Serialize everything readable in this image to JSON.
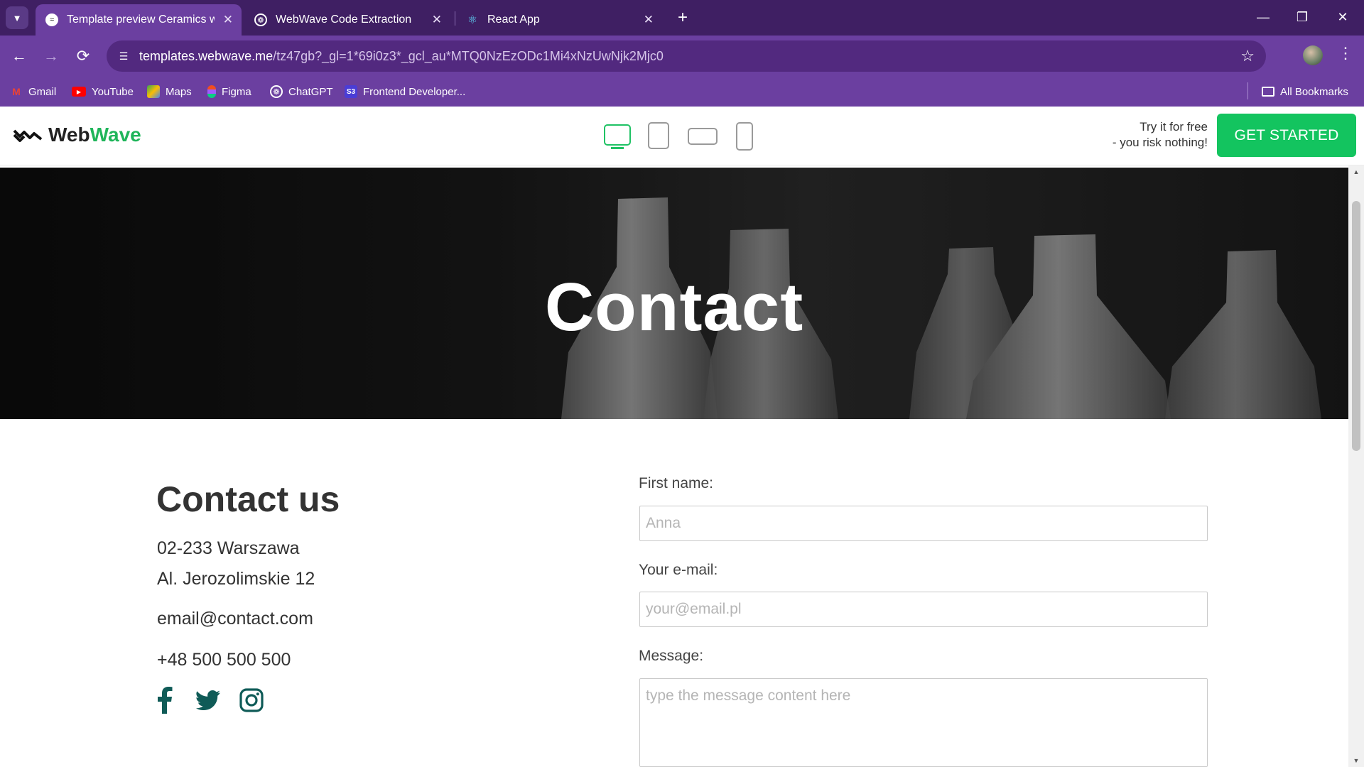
{
  "browser": {
    "tabs": [
      {
        "title": "Template preview Ceramics wor",
        "active": true,
        "favicon": "webwave-icon"
      },
      {
        "title": "WebWave Code Extraction",
        "active": false,
        "favicon": "chatgpt-icon"
      },
      {
        "title": "React App",
        "active": false,
        "favicon": "react-icon"
      }
    ],
    "url_host": "templates.webwave.me",
    "url_path": "/tz47gb?_gl=1*69i0z3*_gcl_au*MTQ0NzEzODc1Mi4xNzUwNjk2Mjc0",
    "bookmarks": [
      {
        "label": "Gmail",
        "icon": "gmail-icon"
      },
      {
        "label": "YouTube",
        "icon": "youtube-icon"
      },
      {
        "label": "Maps",
        "icon": "maps-icon"
      },
      {
        "label": "Figma",
        "icon": "figma-icon"
      },
      {
        "label": "ChatGPT",
        "icon": "chatgpt-icon"
      },
      {
        "label": "Frontend Developer...",
        "icon": "frontend-icon"
      }
    ],
    "all_bookmarks": "All Bookmarks",
    "theme": {
      "tabbar": "#3f1f63",
      "toolbar": "#6b3fa0"
    }
  },
  "header": {
    "logo_web": "Web",
    "logo_wave": "Wave",
    "try_line1": "Try it for free",
    "try_line2": "- you risk nothing!",
    "cta": "GET STARTED",
    "accent": "#13c45f"
  },
  "hero": {
    "title": "Contact"
  },
  "contact": {
    "heading": "Contact us",
    "address_line1": "02-233 Warszawa",
    "address_line2": "Al. Jerozolimskie 12",
    "email": "email@contact.com",
    "phone": "+48 500 500 500",
    "social_color": "#0f5b57"
  },
  "form": {
    "first_name_label": "First name:",
    "first_name_placeholder": "Anna",
    "email_label": "Your e-mail:",
    "email_placeholder": "your@email.pl",
    "message_label": "Message:",
    "message_placeholder": "type the message content here"
  }
}
